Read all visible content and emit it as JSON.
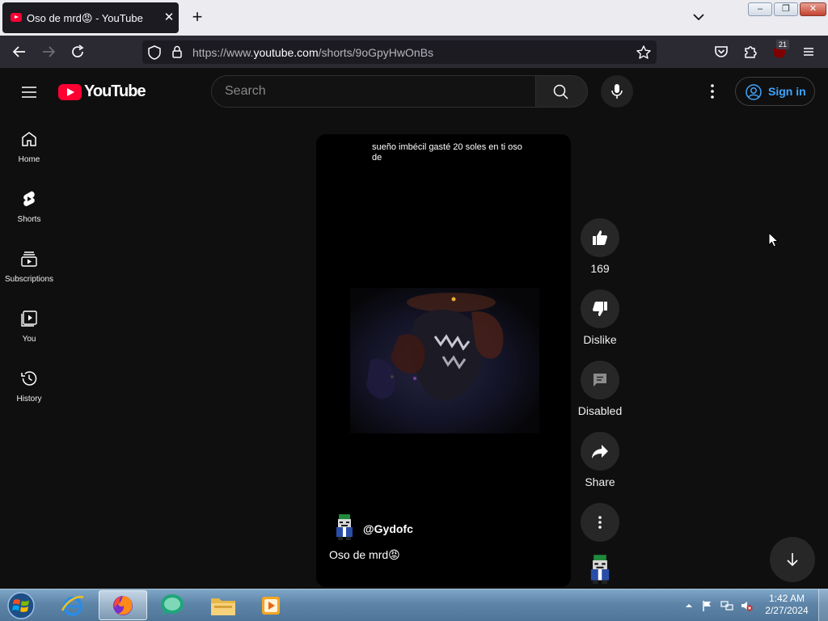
{
  "browser": {
    "tab_title": "Oso de mrd😡 - YouTube",
    "tab_close": "✕",
    "new_tab": "+",
    "url_prefix": "https://www.",
    "url_domain": "youtube.com",
    "url_path": "/shorts/9oGpyHwOnBs",
    "extension_badge": "21",
    "window_controls": {
      "minimize": "–",
      "restore": "❐",
      "close": "✕"
    }
  },
  "masthead": {
    "logo_text": "YouTube",
    "search_placeholder": "Search",
    "sign_in_label": "Sign in"
  },
  "guide": {
    "items": [
      {
        "label": "Home",
        "icon": "home-icon"
      },
      {
        "label": "Shorts",
        "icon": "shorts-icon"
      },
      {
        "label": "Subscriptions",
        "icon": "subscriptions-icon"
      },
      {
        "label": "You",
        "icon": "you-icon"
      },
      {
        "label": "History",
        "icon": "history-icon"
      }
    ]
  },
  "short": {
    "overlay_text": "sueño imbécil gasté 20 soles en ti oso de",
    "channel_handle": "@Gydofc",
    "title": "Oso de mrd😡"
  },
  "actions": {
    "like_count": "169",
    "dislike_label": "Dislike",
    "comments_label": "Disabled",
    "share_label": "Share"
  },
  "taskbar": {
    "apps": [
      "internet-explorer",
      "firefox",
      "chat-app",
      "file-explorer",
      "media-player"
    ],
    "active_app": "firefox",
    "time": "1:42 AM",
    "date": "2/27/2024"
  },
  "colors": {
    "youtube_red": "#ff0033",
    "page_bg": "#0f0f0f",
    "sign_in_blue": "#3ea6ff"
  }
}
